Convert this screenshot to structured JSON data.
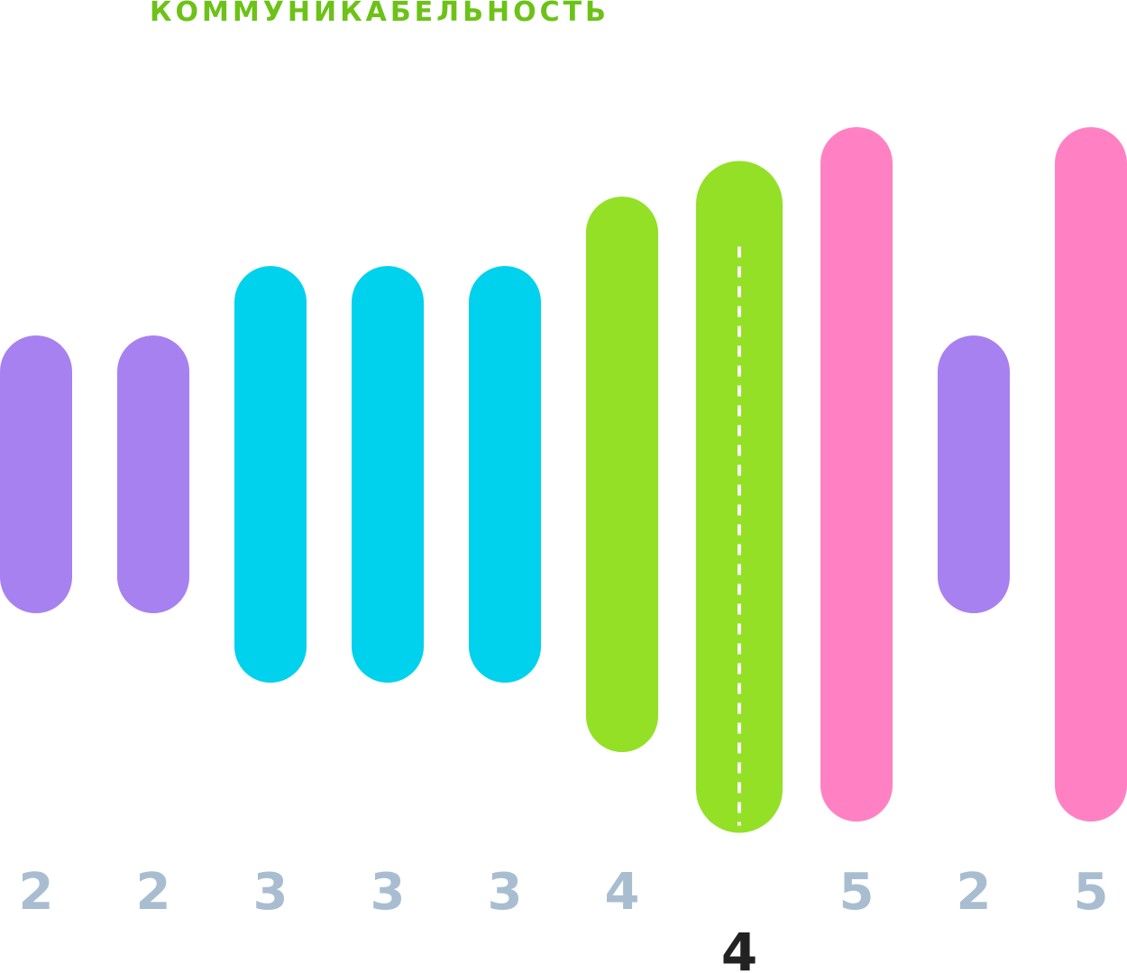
{
  "chart_data": {
    "type": "bar",
    "title": "КОММУНИКАБЕЛЬНОСТЬ",
    "categories": [
      "2",
      "2",
      "3",
      "3",
      "3",
      "4",
      "5",
      "2",
      "5"
    ],
    "values": [
      2,
      2,
      3,
      3,
      3,
      4,
      5,
      2,
      5
    ],
    "average": {
      "label": "4",
      "value": 4,
      "position_after_index": 5
    },
    "ylim": [
      0,
      5
    ],
    "grid": false,
    "legend": "none",
    "colors": {
      "title": "#6cc217",
      "level_2": "#a881f0",
      "level_3": "#00d1ed",
      "level_4": "#93e027",
      "level_5": "#ff81c4",
      "tick_labels": "#a9bdd1",
      "average_label": "#222222",
      "average_dash": "#ffffff"
    }
  }
}
